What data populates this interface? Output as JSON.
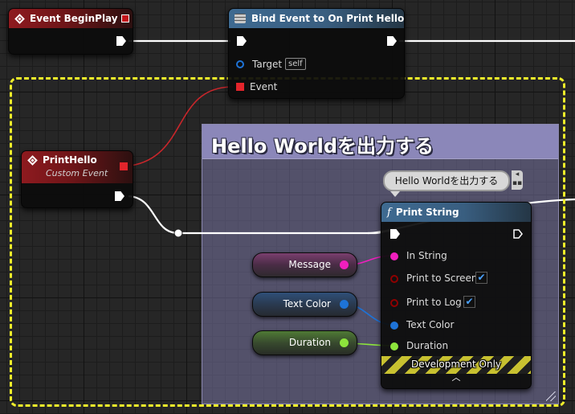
{
  "nodes": {
    "begin_play": {
      "title": "Event BeginPlay"
    },
    "bind_event": {
      "title": "Bind Event to On Print Hello",
      "target_label": "Target",
      "target_value": "self",
      "event_label": "Event"
    },
    "print_hello": {
      "title": "PrintHello",
      "subtitle": "Custom Event"
    },
    "print_string": {
      "title": "Print String",
      "pins": {
        "in_string": "In String",
        "print_to_screen": "Print to Screen",
        "print_to_log": "Print to Log",
        "text_color": "Text Color",
        "duration": "Duration"
      },
      "print_to_screen_checked": true,
      "print_to_log_checked": true,
      "dev_only": "Development Only"
    }
  },
  "comment": {
    "title": "Hello Worldを出力する",
    "bubble": "Hello Worldを出力する"
  },
  "variables": [
    {
      "label": "Message",
      "type": "string"
    },
    {
      "label": "Text Color",
      "type": "color"
    },
    {
      "label": "Duration",
      "type": "float"
    }
  ],
  "colors": {
    "exec": "#ffffff",
    "delegate": "#e3242b",
    "string": "#f01fbe",
    "struct": "#1e73d7",
    "float": "#8de53c",
    "bool": "#8f0000",
    "selection": "#f0ef2a",
    "comment": "#8b87b9"
  },
  "icons": {
    "event": "event-diamond-icon",
    "bind": "bind-event-icon",
    "function": "function-f-icon",
    "checkmark": "✔",
    "expand": "chevron-up-icon"
  }
}
